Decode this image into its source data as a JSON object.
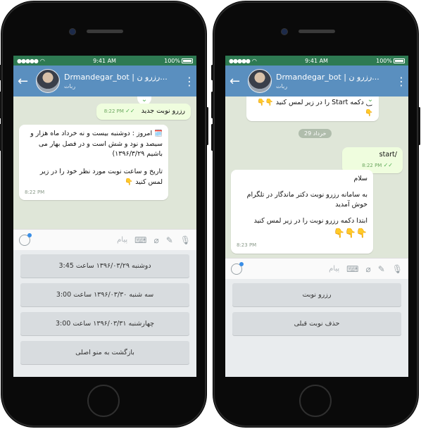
{
  "status": {
    "time": "9:41 AM",
    "battery": "100%"
  },
  "left": {
    "chat_title": "Drmandegar_bot | رزرو ن...",
    "chat_subtitle": "ربات",
    "msg_out": {
      "text": "رزرو نوبت جدید",
      "time": "8:22 PM"
    },
    "msg_in": {
      "line1": "🗓️ امروز : دوشنبه بیست و نه خرداد ماه هزار و سیصد و نود و شش است و در فصل بهار می باشیم ۱۳۹۶/۳/۲۹)",
      "line2": "تاریخ و ساعت نوبت مورد نظر خود را در زیر لمس کنید 👇",
      "time": "8:22 PM"
    },
    "composer_placeholder": "پیام",
    "buttons": [
      "دوشنبه ۱۳۹۶/۰۳/۲۹ ساعت 3:45",
      "سه شنبه ۱۳۹۶/۰۳/۳۰ ساعت 3:00",
      "چهارشنبه ۱۳۹۶/۰۳/۳۱ ساعت 3:00",
      "بازگشت به منو اصلی"
    ]
  },
  "right": {
    "chat_title": "Drmandegar_bot | رزرو ن...",
    "chat_subtitle": "ربات",
    "msg_top": {
      "text": "وع دکمه Start را در زیر لمس کنید 👇👇👇"
    },
    "date_pill": "29 خرداد",
    "msg_out": {
      "text": "/start",
      "time": "8:22 PM"
    },
    "msg_in": {
      "greeting": "سلام",
      "line1": "به سامانه رزرو نوبت دکتر ماندگار در تلگرام خوش آمدید",
      "line2": "ابتدا دکمه رزرو نوبت را در زیر لمس کنید",
      "emoji": "👇👇👇",
      "time": "8:23 PM"
    },
    "composer_placeholder": "پیام",
    "buttons": [
      "رزرو نوبت",
      "حذف نوبت قبلی"
    ]
  },
  "colors": {
    "header": "#5a8fbf",
    "status": "#2e7a52",
    "chat_bg": "#dfe6d8",
    "out_bubble": "#effdde"
  }
}
